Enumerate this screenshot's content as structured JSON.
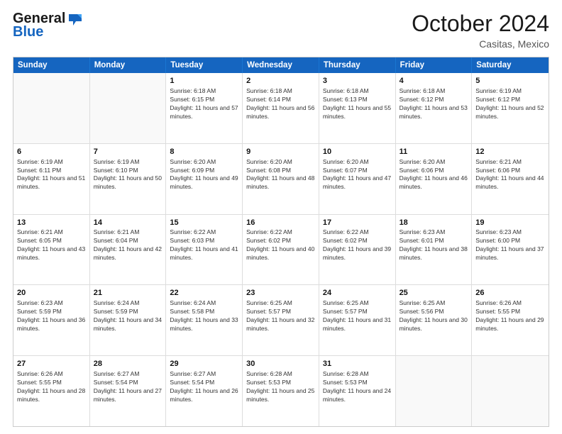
{
  "header": {
    "logo_line1": "General",
    "logo_line2": "Blue",
    "title": "October 2024",
    "location": "Casitas, Mexico"
  },
  "weekdays": [
    "Sunday",
    "Monday",
    "Tuesday",
    "Wednesday",
    "Thursday",
    "Friday",
    "Saturday"
  ],
  "weeks": [
    [
      {
        "day": "",
        "sunrise": "",
        "sunset": "",
        "daylight": ""
      },
      {
        "day": "",
        "sunrise": "",
        "sunset": "",
        "daylight": ""
      },
      {
        "day": "1",
        "sunrise": "Sunrise: 6:18 AM",
        "sunset": "Sunset: 6:15 PM",
        "daylight": "Daylight: 11 hours and 57 minutes."
      },
      {
        "day": "2",
        "sunrise": "Sunrise: 6:18 AM",
        "sunset": "Sunset: 6:14 PM",
        "daylight": "Daylight: 11 hours and 56 minutes."
      },
      {
        "day": "3",
        "sunrise": "Sunrise: 6:18 AM",
        "sunset": "Sunset: 6:13 PM",
        "daylight": "Daylight: 11 hours and 55 minutes."
      },
      {
        "day": "4",
        "sunrise": "Sunrise: 6:18 AM",
        "sunset": "Sunset: 6:12 PM",
        "daylight": "Daylight: 11 hours and 53 minutes."
      },
      {
        "day": "5",
        "sunrise": "Sunrise: 6:19 AM",
        "sunset": "Sunset: 6:12 PM",
        "daylight": "Daylight: 11 hours and 52 minutes."
      }
    ],
    [
      {
        "day": "6",
        "sunrise": "Sunrise: 6:19 AM",
        "sunset": "Sunset: 6:11 PM",
        "daylight": "Daylight: 11 hours and 51 minutes."
      },
      {
        "day": "7",
        "sunrise": "Sunrise: 6:19 AM",
        "sunset": "Sunset: 6:10 PM",
        "daylight": "Daylight: 11 hours and 50 minutes."
      },
      {
        "day": "8",
        "sunrise": "Sunrise: 6:20 AM",
        "sunset": "Sunset: 6:09 PM",
        "daylight": "Daylight: 11 hours and 49 minutes."
      },
      {
        "day": "9",
        "sunrise": "Sunrise: 6:20 AM",
        "sunset": "Sunset: 6:08 PM",
        "daylight": "Daylight: 11 hours and 48 minutes."
      },
      {
        "day": "10",
        "sunrise": "Sunrise: 6:20 AM",
        "sunset": "Sunset: 6:07 PM",
        "daylight": "Daylight: 11 hours and 47 minutes."
      },
      {
        "day": "11",
        "sunrise": "Sunrise: 6:20 AM",
        "sunset": "Sunset: 6:06 PM",
        "daylight": "Daylight: 11 hours and 46 minutes."
      },
      {
        "day": "12",
        "sunrise": "Sunrise: 6:21 AM",
        "sunset": "Sunset: 6:06 PM",
        "daylight": "Daylight: 11 hours and 44 minutes."
      }
    ],
    [
      {
        "day": "13",
        "sunrise": "Sunrise: 6:21 AM",
        "sunset": "Sunset: 6:05 PM",
        "daylight": "Daylight: 11 hours and 43 minutes."
      },
      {
        "day": "14",
        "sunrise": "Sunrise: 6:21 AM",
        "sunset": "Sunset: 6:04 PM",
        "daylight": "Daylight: 11 hours and 42 minutes."
      },
      {
        "day": "15",
        "sunrise": "Sunrise: 6:22 AM",
        "sunset": "Sunset: 6:03 PM",
        "daylight": "Daylight: 11 hours and 41 minutes."
      },
      {
        "day": "16",
        "sunrise": "Sunrise: 6:22 AM",
        "sunset": "Sunset: 6:02 PM",
        "daylight": "Daylight: 11 hours and 40 minutes."
      },
      {
        "day": "17",
        "sunrise": "Sunrise: 6:22 AM",
        "sunset": "Sunset: 6:02 PM",
        "daylight": "Daylight: 11 hours and 39 minutes."
      },
      {
        "day": "18",
        "sunrise": "Sunrise: 6:23 AM",
        "sunset": "Sunset: 6:01 PM",
        "daylight": "Daylight: 11 hours and 38 minutes."
      },
      {
        "day": "19",
        "sunrise": "Sunrise: 6:23 AM",
        "sunset": "Sunset: 6:00 PM",
        "daylight": "Daylight: 11 hours and 37 minutes."
      }
    ],
    [
      {
        "day": "20",
        "sunrise": "Sunrise: 6:23 AM",
        "sunset": "Sunset: 5:59 PM",
        "daylight": "Daylight: 11 hours and 36 minutes."
      },
      {
        "day": "21",
        "sunrise": "Sunrise: 6:24 AM",
        "sunset": "Sunset: 5:59 PM",
        "daylight": "Daylight: 11 hours and 34 minutes."
      },
      {
        "day": "22",
        "sunrise": "Sunrise: 6:24 AM",
        "sunset": "Sunset: 5:58 PM",
        "daylight": "Daylight: 11 hours and 33 minutes."
      },
      {
        "day": "23",
        "sunrise": "Sunrise: 6:25 AM",
        "sunset": "Sunset: 5:57 PM",
        "daylight": "Daylight: 11 hours and 32 minutes."
      },
      {
        "day": "24",
        "sunrise": "Sunrise: 6:25 AM",
        "sunset": "Sunset: 5:57 PM",
        "daylight": "Daylight: 11 hours and 31 minutes."
      },
      {
        "day": "25",
        "sunrise": "Sunrise: 6:25 AM",
        "sunset": "Sunset: 5:56 PM",
        "daylight": "Daylight: 11 hours and 30 minutes."
      },
      {
        "day": "26",
        "sunrise": "Sunrise: 6:26 AM",
        "sunset": "Sunset: 5:55 PM",
        "daylight": "Daylight: 11 hours and 29 minutes."
      }
    ],
    [
      {
        "day": "27",
        "sunrise": "Sunrise: 6:26 AM",
        "sunset": "Sunset: 5:55 PM",
        "daylight": "Daylight: 11 hours and 28 minutes."
      },
      {
        "day": "28",
        "sunrise": "Sunrise: 6:27 AM",
        "sunset": "Sunset: 5:54 PM",
        "daylight": "Daylight: 11 hours and 27 minutes."
      },
      {
        "day": "29",
        "sunrise": "Sunrise: 6:27 AM",
        "sunset": "Sunset: 5:54 PM",
        "daylight": "Daylight: 11 hours and 26 minutes."
      },
      {
        "day": "30",
        "sunrise": "Sunrise: 6:28 AM",
        "sunset": "Sunset: 5:53 PM",
        "daylight": "Daylight: 11 hours and 25 minutes."
      },
      {
        "day": "31",
        "sunrise": "Sunrise: 6:28 AM",
        "sunset": "Sunset: 5:53 PM",
        "daylight": "Daylight: 11 hours and 24 minutes."
      },
      {
        "day": "",
        "sunrise": "",
        "sunset": "",
        "daylight": ""
      },
      {
        "day": "",
        "sunrise": "",
        "sunset": "",
        "daylight": ""
      }
    ]
  ]
}
